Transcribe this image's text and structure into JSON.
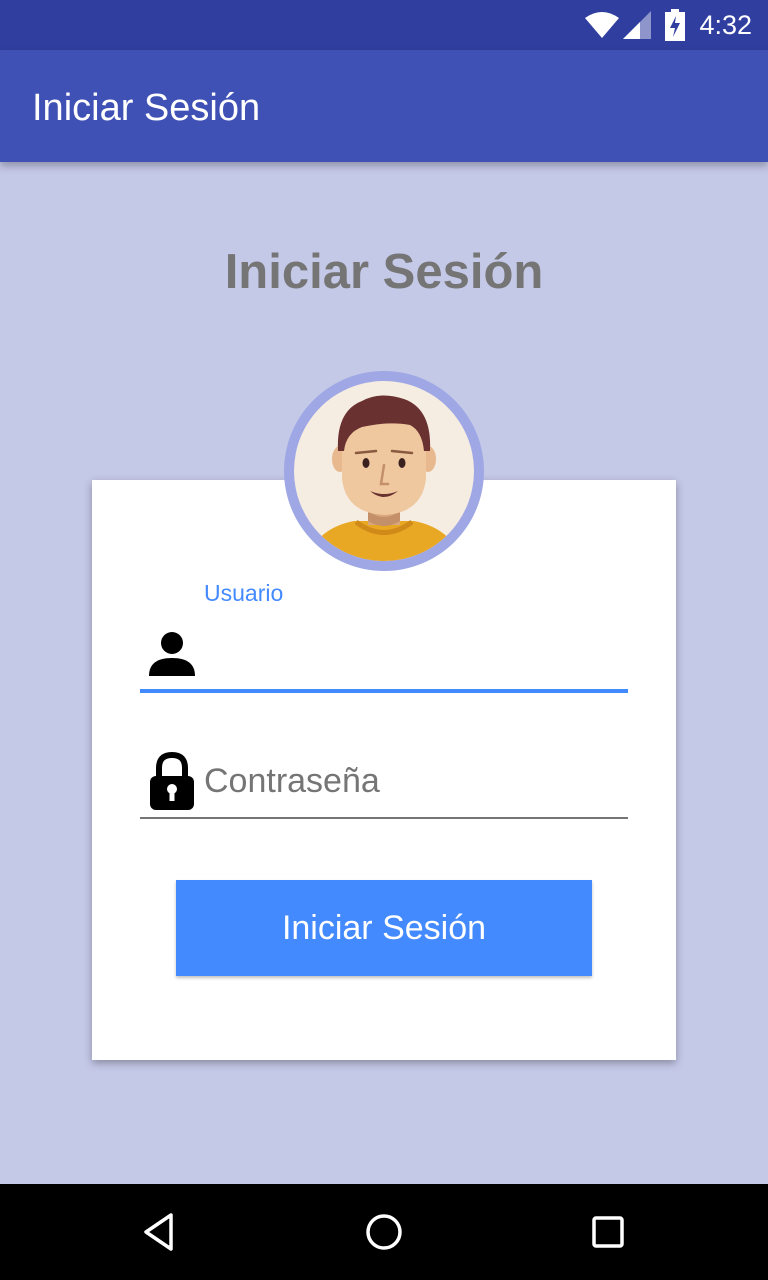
{
  "status_bar": {
    "time": "4:32",
    "icons": [
      "wifi-icon",
      "cell-signal-icon",
      "battery-charging-icon"
    ]
  },
  "app_bar": {
    "title": "Iniciar Sesión"
  },
  "main": {
    "heading": "Iniciar Sesión",
    "avatar": "avatar-illustration",
    "username": {
      "label": "Usuario",
      "value": "",
      "icon": "person-icon"
    },
    "password": {
      "placeholder": "Contraseña",
      "value": "",
      "icon": "lock-icon"
    },
    "login_button": "Iniciar Sesión"
  },
  "nav_bar": {
    "icons": [
      "back-icon",
      "home-icon",
      "recents-icon"
    ]
  },
  "colors": {
    "status_bar": "#303f9f",
    "app_bar": "#3f51b5",
    "background": "#c5c9e8",
    "accent": "#448aff",
    "heading_text": "#757575",
    "avatar_ring": "#9fa8e4",
    "avatar_shirt": "#e8a824"
  }
}
